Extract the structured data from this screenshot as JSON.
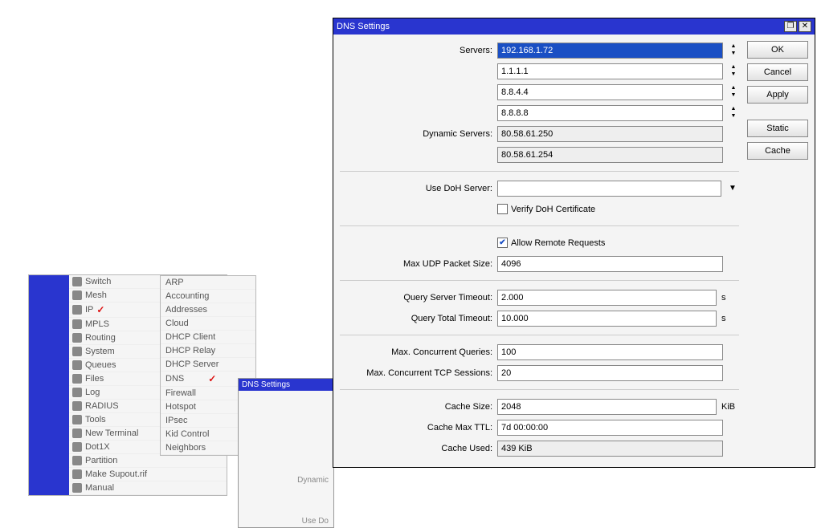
{
  "bg": {
    "menu": [
      "Switch",
      "Mesh",
      "IP",
      "MPLS",
      "Routing",
      "System",
      "Queues",
      "Files",
      "Log",
      "RADIUS",
      "Tools",
      "New Terminal",
      "Dot1X",
      "Partition",
      "Make Supout.rif",
      "Manual"
    ],
    "submenu": [
      "ARP",
      "Accounting",
      "Addresses",
      "Cloud",
      "DHCP Client",
      "DHCP Relay",
      "DHCP Server",
      "DNS",
      "Firewall",
      "Hotspot",
      "IPsec",
      "Kid Control",
      "Neighbors"
    ],
    "smalltitle": "DNS Settings",
    "smalld1": "Dynamic",
    "smalld2": "Use Do"
  },
  "dialog": {
    "title": "DNS Settings",
    "labels": {
      "servers": "Servers:",
      "dynservers": "Dynamic Servers:",
      "usedoh": "Use DoH Server:",
      "verifydoh": "Verify DoH Certificate",
      "allowremote": "Allow Remote Requests",
      "maxudp": "Max UDP Packet Size:",
      "qservert": "Query Server Timeout:",
      "qtotalt": "Query Total Timeout:",
      "maxconcq": "Max. Concurrent Queries:",
      "maxconctcp": "Max. Concurrent TCP Sessions:",
      "cachesize": "Cache Size:",
      "cachemaxttl": "Cache Max TTL:",
      "cacheused": "Cache Used:"
    },
    "values": {
      "server1": "192.168.1.72",
      "server2": "1.1.1.1",
      "server3": "8.8.4.4",
      "server4": "8.8.8.8",
      "dyn1": "80.58.61.250",
      "dyn2": "80.58.61.254",
      "doh": "",
      "verifydoh": false,
      "allowremote": true,
      "maxudp": "4096",
      "qservert": "2.000",
      "qtotalt": "10.000",
      "maxconcq": "100",
      "maxconctcp": "20",
      "cachesize": "2048",
      "cachemaxttl": "7d 00:00:00",
      "cacheused": "439 KiB"
    },
    "units": {
      "sec": "s",
      "kib": "KiB"
    },
    "buttons": {
      "ok": "OK",
      "cancel": "Cancel",
      "apply": "Apply",
      "static": "Static",
      "cache": "Cache"
    }
  }
}
